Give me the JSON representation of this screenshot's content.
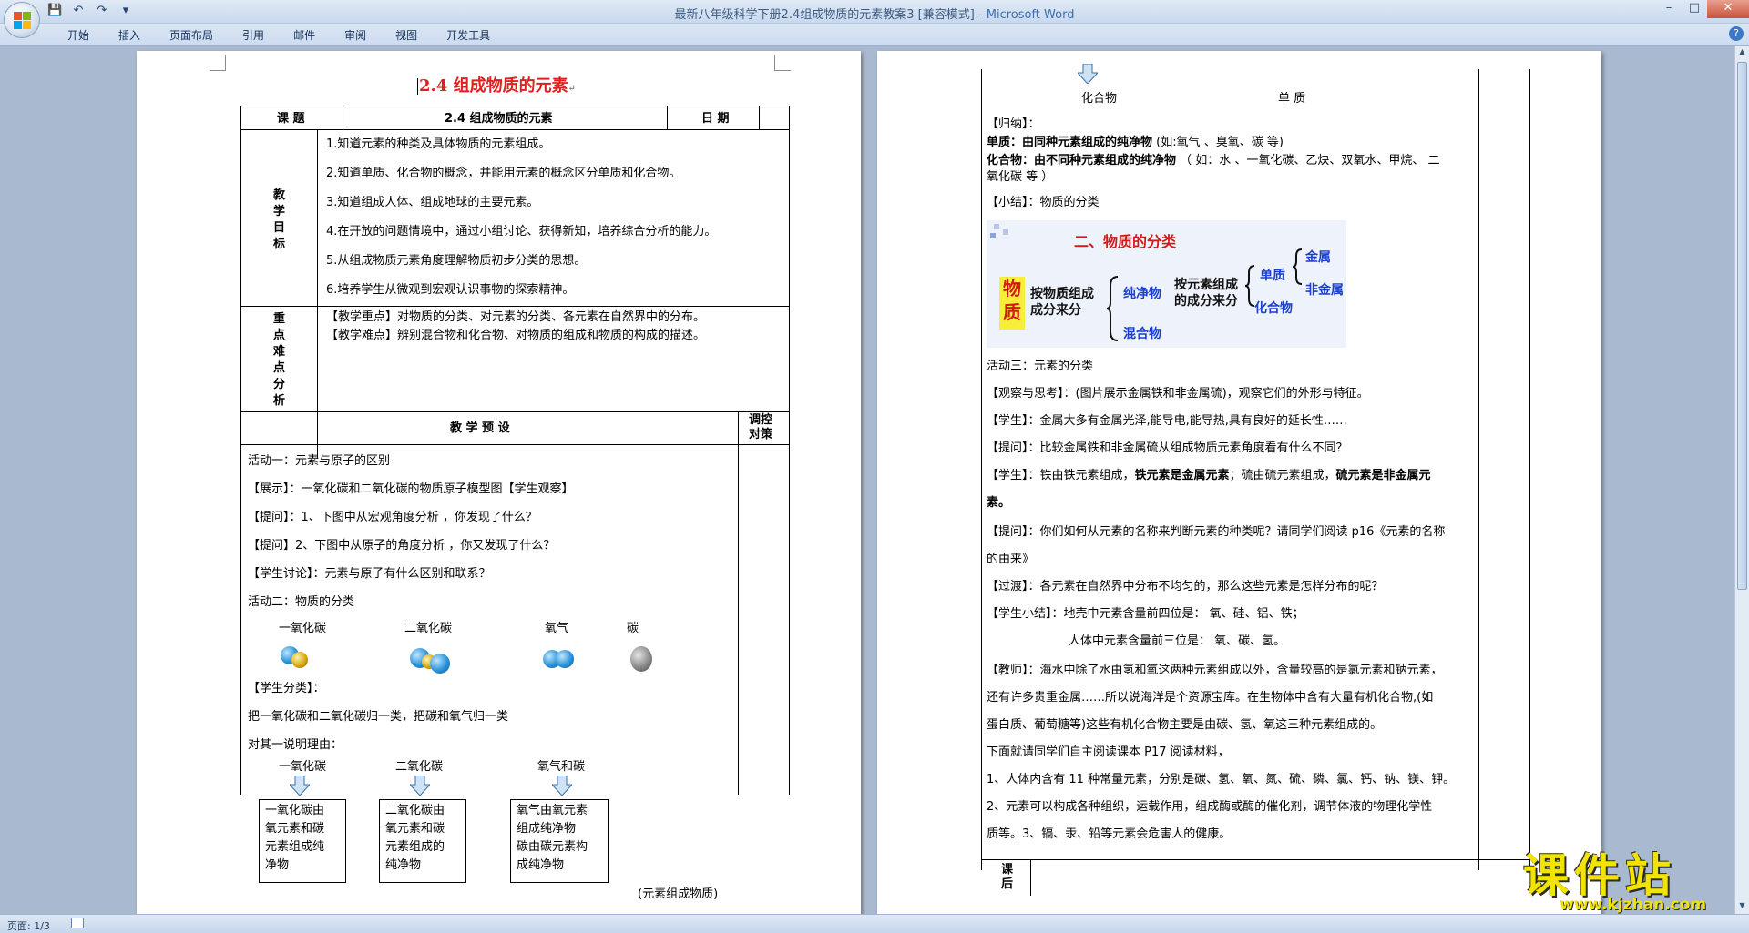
{
  "window": {
    "title": "最新八年级科学下册2.4组成物质的元素教案3 [兼容模式] - ",
    "app_name": "Microsoft Word",
    "qat": [
      "💾",
      "↶",
      "↷",
      "▾"
    ],
    "controls": {
      "minimize": "–",
      "maximize": "□",
      "close": "✕"
    }
  },
  "ribbon": {
    "tabs": [
      "开始",
      "插入",
      "页面布局",
      "引用",
      "邮件",
      "审阅",
      "视图",
      "开发工具"
    ],
    "help": "?"
  },
  "page1": {
    "title": "2.4  组成物质的元素",
    "header": {
      "course_label": "课  题",
      "course_value": "2.4  组成物质的元素",
      "date_label": "日  期"
    },
    "goals_label": [
      "教",
      "学",
      "目",
      "标"
    ],
    "goals": [
      "1.知道元素的种类及具体物质的元素组成。",
      "2.知道单质、化合物的概念，并能用元素的概念区分单质和化合物。",
      "3.知道组成人体、组成地球的主要元素。",
      "4.在开放的问题情境中，通过小组讨论、获得新知，培养综合分析的能力。",
      "5.从组成物质元素角度理解物质初步分类的思想。",
      "6.培养学生从微观到宏观认识事物的探索精神。"
    ],
    "key_label": [
      "重",
      "点",
      "难",
      "点",
      "分",
      "析"
    ],
    "key_points": [
      "【教学重点】对物质的分类、对元素的分类、各元素在自然界中的分布。",
      "【教学难点】辨别混合物和化合物、对物质的组成和物质的构成的描述。"
    ],
    "plan_label": "教 学 预 设",
    "adjust_label": [
      "调控",
      "对策"
    ],
    "activities": [
      "活动一：元素与原子的区别",
      "【展示】：一氧化碳和二氧化碳的物质原子模型图【学生观察】",
      "【提问】：1、下图中从宏观角度分析 ，你发现了什么？",
      "【提问】2、下图中从原子的角度分析 ，你又发现了什么？",
      "【学生讨论】：元素与原子有什么区别和联系？",
      "活动二：物质的分类"
    ],
    "molecules": [
      "一氧化碳",
      "二氧化碳",
      "氧气",
      "碳"
    ],
    "classify_lines": [
      "【学生分类】：",
      "把一氧化碳和二氧化碳归一类，把碳和氧气归一类",
      "对其一说明理由："
    ],
    "group_labels": [
      "一氧化碳",
      "二氧化碳",
      "氧气和碳"
    ],
    "group_boxes": [
      [
        "一氧化碳由",
        "氧元素和碳",
        "元素组成纯",
        "净物"
      ],
      [
        "二氧化碳由",
        "氧元素和碳",
        "元素组成的",
        "纯净物"
      ],
      [
        "氧气由氧元素",
        "组成纯净物",
        "碳由碳元素构",
        "成纯净物"
      ]
    ],
    "note": "(元素组成物质)"
  },
  "page2": {
    "top_labels": [
      "化合物",
      "单 质"
    ],
    "summary_head": "【归纳】：",
    "elem_def": {
      "bold": "单质：由同种元素组成的纯净物",
      "rest": "   (如:氧气 、臭氧、碳   等)"
    },
    "comp_def": {
      "bold": "化合物：由不同种元素组成的纯净物",
      "rest": "  （ 如：水 、一氧化碳、乙炔、双氧水、甲烷、 二"
    },
    "comp_def2": "氧化碳 等 ）",
    "small_summary": "【小结】：物质的分类",
    "class_img": {
      "title": "二、物质的分类",
      "wuzhi": [
        "物",
        "质"
      ],
      "by_comp": "按物质组成",
      "by_comp2": "成分来分",
      "pure": "纯净物",
      "mixed": "混合物",
      "by_elem": "按元素组成",
      "by_elem2": "的成分来分",
      "simple": "单质",
      "compound": "化合物",
      "metal": "金属",
      "nonmetal": "非金属"
    },
    "lines": [
      "活动三：元素的分类",
      "【观察与思考】：(图片展示金属铁和非金属硫)，观察它们的外形与特征。",
      "【学生】：金属大多有金属光泽,能导电,能导热,具有良好的延长性……",
      "【提问】：比较金属铁和非金属硫从组成物质元素角度看有什么不同？",
      "【学生】：铁由铁元素组成，",
      "铁元素是金属元素",
      "；硫由硫元素组成，",
      "硫元素是非金属元",
      "素。",
      "【提问】：你们如何从元素的名称来判断元素的种类呢？请同学们阅读 p16《元素的名称",
      "的由来》",
      "【过渡】：各元素在自然界中分布不均匀的，那么这些元素是怎样分布的呢？",
      "【学生小结】：地壳中元素含量前四位是：  氧、硅、铝、铁；",
      "人体中元素含量前三位是：  氧、碳、氢。",
      "【教师】：海水中除了水由氢和氧这两种元素组成以外，含量较高的是氯元素和钠元素，",
      "还有许多贵重金属……所以说海洋是个资源宝库。在生物体中含有大量有机化合物,(如",
      "蛋白质、葡萄糖等)这些有机化合物主要是由碳、氢、氧这三种元素组成的。",
      "下面就请同学们自主阅读课本 P17 阅读材料，",
      "1、人体内含有 11 种常量元素，分别是碳、氢、氧、氮、硫、磷、氯、钙、钠、镁、钾。",
      "2、元素可以构成各种组织，运载作用，组成酶或酶的催化剂，调节体液的物理化学性",
      "质等。3、镉、汞、铅等元素会危害人的健康。"
    ],
    "bottom_label": [
      "课",
      "后"
    ]
  },
  "status": {
    "page": "页面: 1/3"
  },
  "watermark": {
    "big": "课件站",
    "url": "www.kjzhan.com"
  }
}
